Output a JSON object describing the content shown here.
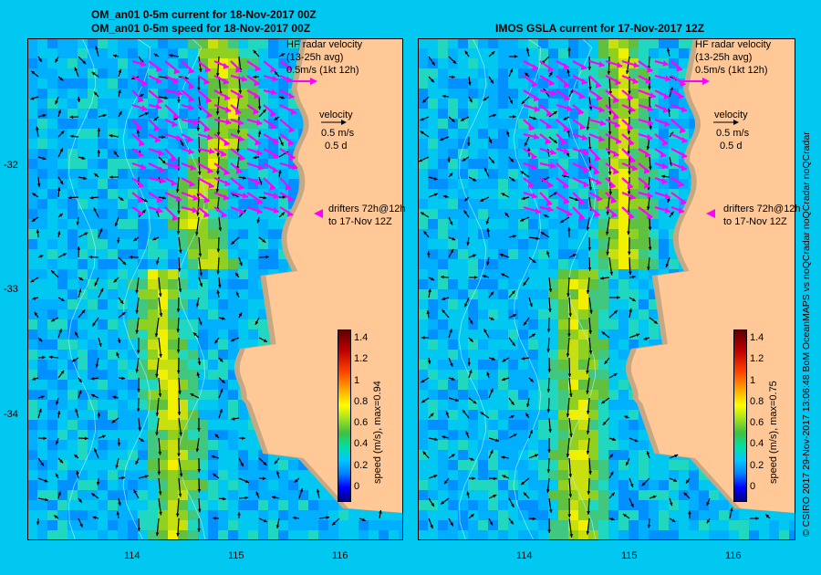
{
  "colors": {
    "background": "#00c8f0",
    "land": "#ffc896",
    "coast_shallow": "#c8a882",
    "radar_arrow": "#ff00ff",
    "drifter_trail": "#ffffff",
    "contour": "#a0f0ff"
  },
  "panel_left": {
    "title_line1": "OM_an01 0-5m current for 18-Nov-2017 00Z",
    "title_line2": "OM_an01 0-5m speed for 18-Nov-2017 00Z",
    "radar_label1": "HF radar velocity",
    "radar_label2": "(13-25h avg)",
    "radar_label3": "0.5m/s (1kt 12h)",
    "velocity_label1": "velocity",
    "velocity_label2": "0.5 m/s",
    "velocity_label3": "0.5 d",
    "drifters_label1": "drifters 72h@12h",
    "drifters_label2": "to 17-Nov 12Z",
    "colorbar_label": "speed (m/s), max=0.94",
    "colorbar_ticks": [
      "1.4",
      "1.2",
      "1",
      "0.8",
      "0.6",
      "0.4",
      "0.2",
      "0"
    ]
  },
  "panel_right": {
    "title": "IMOS GSLA current for 17-Nov-2017 12Z",
    "radar_label1": "HF radar velocity",
    "radar_label2": "(13-25h avg)",
    "radar_label3": "0.5m/s (1kt 12h)",
    "velocity_label1": "velocity",
    "velocity_label2": "0.5 m/s",
    "velocity_label3": "0.5 d",
    "drifters_label1": "drifters 72h@12h",
    "drifters_label2": "to 17-Nov 12Z",
    "colorbar_label": "speed (m/s), max=0.75",
    "colorbar_ticks": [
      "1.4",
      "1.2",
      "1",
      "0.8",
      "0.6",
      "0.4",
      "0.2",
      "0"
    ]
  },
  "lat_ticks": [
    "-32",
    "-33",
    "-34"
  ],
  "lon_ticks": [
    "114",
    "115",
    "116"
  ],
  "side_text": "© CSIRO 2017   29-Nov-2017 13:06:48 BoM OceanMAPS vs noQCradar noQCradar noQCradar"
}
